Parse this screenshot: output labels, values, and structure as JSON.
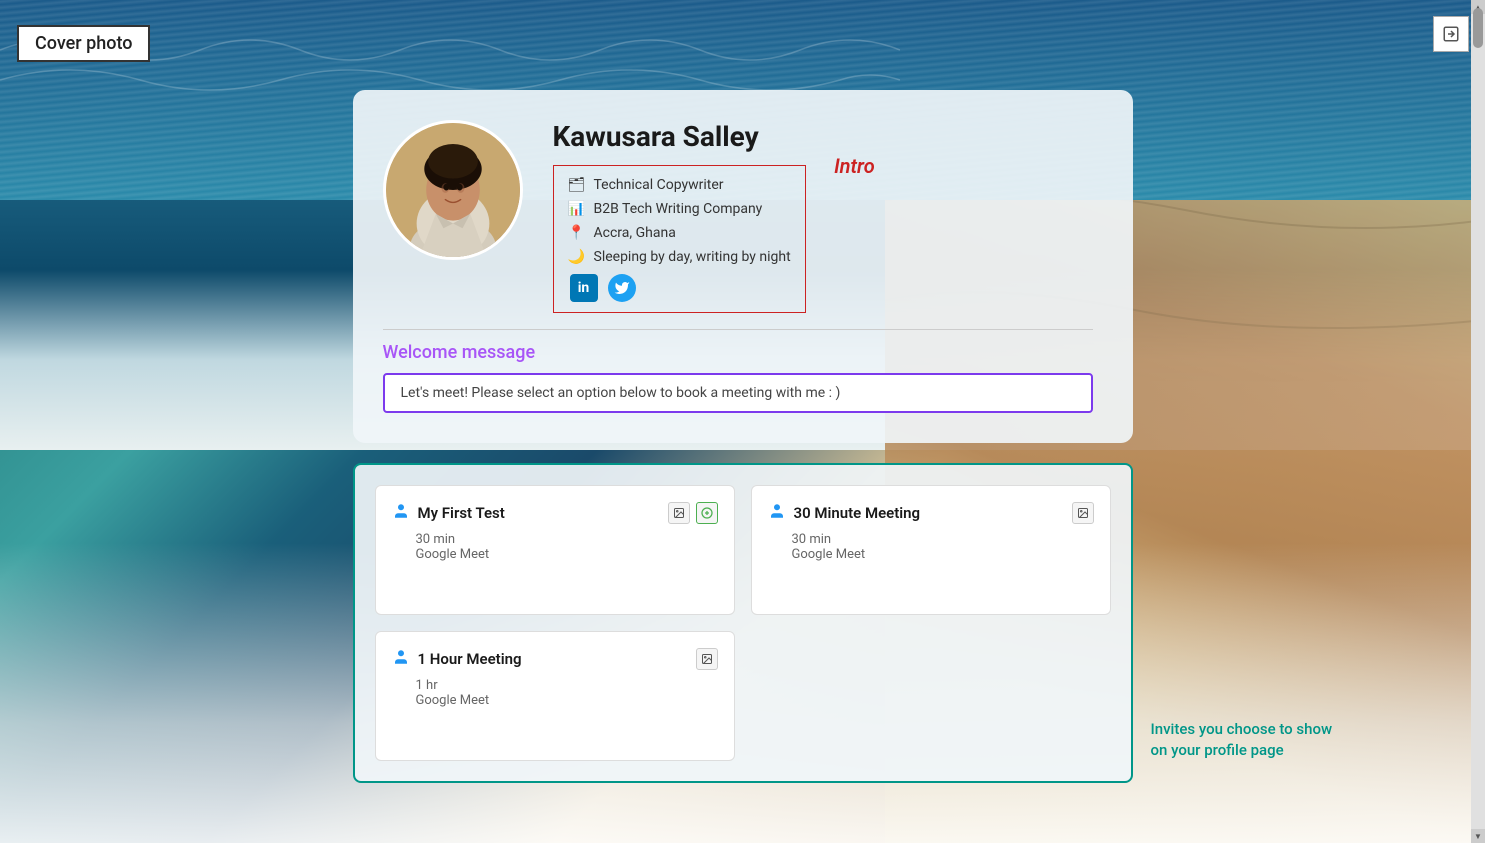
{
  "cover_photo_label": "Cover photo",
  "profile": {
    "name": "Kawusara Salley",
    "intro_label": "Intro",
    "intro_items": [
      {
        "icon": "🗂",
        "text": "Technical Copywriter"
      },
      {
        "icon": "📊",
        "text": "B2B Tech Writing Company"
      },
      {
        "icon": "📍",
        "text": "Accra, Ghana"
      },
      {
        "icon": "🌙",
        "text": "Sleeping by day, writing by night"
      }
    ],
    "social": {
      "linkedin_label": "in",
      "twitter_label": "🐦"
    }
  },
  "welcome": {
    "label": "Welcome message",
    "message": "Let's meet! Please select an option below to book a meeting with me : )"
  },
  "meetings": [
    {
      "title": "My First Test",
      "duration": "30 min",
      "platform": "Google Meet",
      "icons": [
        "image",
        "circle-plus"
      ]
    },
    {
      "title": "30 Minute Meeting",
      "duration": "30 min",
      "platform": "Google Meet",
      "icons": [
        "image"
      ]
    },
    {
      "title": "1 Hour Meeting",
      "duration": "1 hr",
      "platform": "Google Meet",
      "icons": [
        "image"
      ]
    }
  ],
  "invites_note": "Invites you choose to show on your profile page",
  "icons": {
    "export": "⊞",
    "person": "👤",
    "image": "⊟",
    "circle_plus": "⊕"
  }
}
